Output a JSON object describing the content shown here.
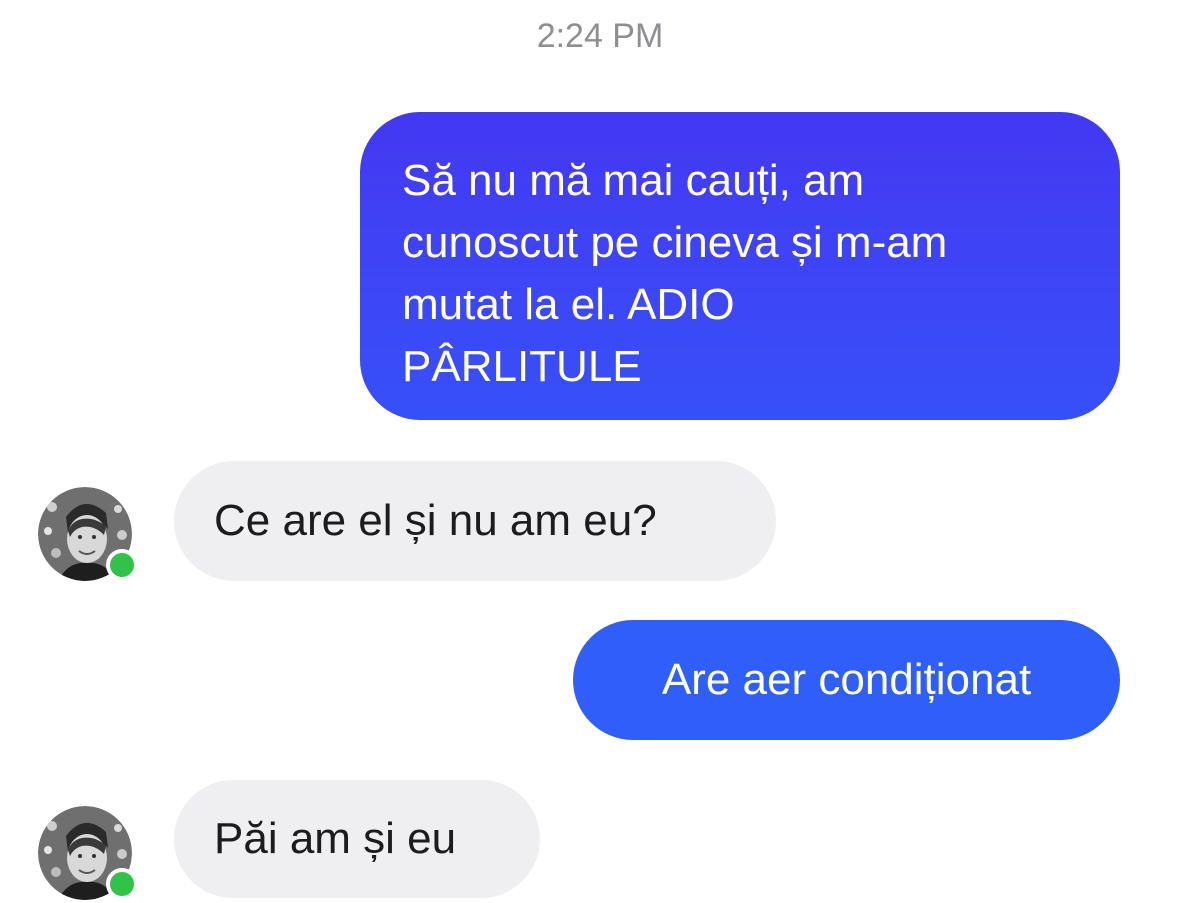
{
  "conversation": {
    "timestamp": "2:24 PM",
    "messages": [
      {
        "direction": "outgoing",
        "lines": [
          "Să nu mă mai cauți,  am",
          "cunoscut pe cineva și m-am",
          "mutat la el.  ADIO",
          "PÂRLITULE"
        ]
      },
      {
        "direction": "incoming",
        "text": "Ce are el și nu am eu?",
        "avatar_icon": "contact-avatar",
        "online": true
      },
      {
        "direction": "outgoing",
        "text": "Are aer condiționat"
      },
      {
        "direction": "incoming",
        "text": "Păi am și eu",
        "avatar_icon": "contact-avatar",
        "online": true
      }
    ]
  },
  "colors": {
    "outgoing_bubble": "#3d47f7",
    "outgoing_bubble_alt": "#2f5ff8",
    "incoming_bubble": "#efeff1",
    "online_dot": "#31c24a",
    "timestamp_text": "#8e8e93"
  }
}
